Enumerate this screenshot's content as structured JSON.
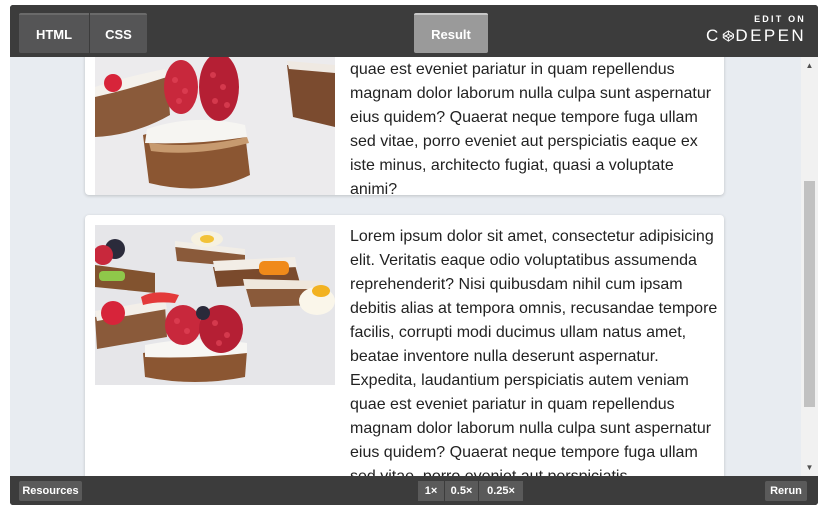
{
  "toolbar": {
    "tabs": [
      {
        "label": "HTML"
      },
      {
        "label": "CSS"
      },
      {
        "label": "Result"
      }
    ],
    "brand": {
      "edit_on": "EDIT ON",
      "name_left": "C",
      "name_right": "DEPEN"
    }
  },
  "cards": [
    {
      "image_alt": "bread with cream cheese and raspberries",
      "text": "quae est eveniet pariatur in quam repellendus magnam dolor laborum nulla culpa sunt aspernatur eius quidem? Quaerat neque tempore fuga ullam sed vitae, porro eveniet aut perspiciatis eaque ex iste minus, architecto fugiat, quasi a voluptate animi?"
    },
    {
      "image_alt": "assorted open sandwiches with fruit",
      "text": "Lorem ipsum dolor sit amet, consectetur adipisicing elit. Veritatis eaque odio voluptatibus assumenda reprehenderit? Nisi quibusdam nihil cum ipsam debitis alias at tempora omnis, recusandae tempore facilis, corrupti modi ducimus ullam natus amet, beatae inventore nulla deserunt aspernatur. Expedita, laudantium perspiciatis autem veniam quae est eveniet pariatur in quam repellendus magnam dolor laborum nulla culpa sunt aspernatur eius quidem? Quaerat neque tempore fuga ullam sed vitae, porro eveniet aut perspiciatis"
    }
  ],
  "footer": {
    "resources_label": "Resources",
    "zoom_options": [
      "1×",
      "0.5×",
      "0.25×"
    ],
    "rerun_label": "Rerun"
  },
  "colors": {
    "toolbar_bg": "#3c3c3c",
    "tab_bg": "#555556",
    "active_tab_bg": "#9a9a9a",
    "viewport_bg": "#e8ecf1",
    "card_bg": "#ffffff",
    "raspberry": "#c8283c"
  },
  "icons": {
    "logo": "codepen-cube-icon",
    "scroll_up": "triangle-up-icon",
    "scroll_down": "triangle-down-icon"
  }
}
